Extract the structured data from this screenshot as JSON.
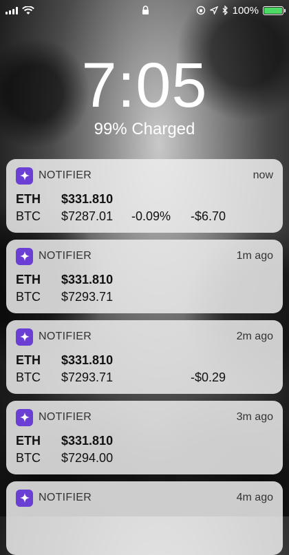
{
  "status_bar": {
    "battery_percent": "100%",
    "icons": [
      "signal-icon",
      "wifi-icon",
      "lock-icon",
      "orientation-lock-icon",
      "location-icon",
      "bluetooth-icon",
      "battery-icon"
    ]
  },
  "lock_screen": {
    "time": "7:05",
    "charge_status": "99% Charged"
  },
  "notifications": [
    {
      "app": "NOTIFIER",
      "time": "now",
      "eth_symbol": "ETH",
      "eth_price": "$331.810",
      "btc_symbol": "BTC",
      "btc_price": "$7287.01",
      "btc_change_pct": "-0.09%",
      "btc_change_abs": "-$6.70"
    },
    {
      "app": "NOTIFIER",
      "time": "1m ago",
      "eth_symbol": "ETH",
      "eth_price": "$331.810",
      "btc_symbol": "BTC",
      "btc_price": "$7293.71",
      "btc_change_pct": "",
      "btc_change_abs": ""
    },
    {
      "app": "NOTIFIER",
      "time": "2m ago",
      "eth_symbol": "ETH",
      "eth_price": "$331.810",
      "btc_symbol": "BTC",
      "btc_price": "$7293.71",
      "btc_change_pct": "",
      "btc_change_abs": "-$0.29"
    },
    {
      "app": "NOTIFIER",
      "time": "3m ago",
      "eth_symbol": "ETH",
      "eth_price": "$331.810",
      "btc_symbol": "BTC",
      "btc_price": "$7294.00",
      "btc_change_pct": "",
      "btc_change_abs": ""
    },
    {
      "app": "NOTIFIER",
      "time": "4m ago"
    }
  ],
  "colors": {
    "app_icon": "#6b3fd4",
    "battery_fill": "#4cd964"
  }
}
